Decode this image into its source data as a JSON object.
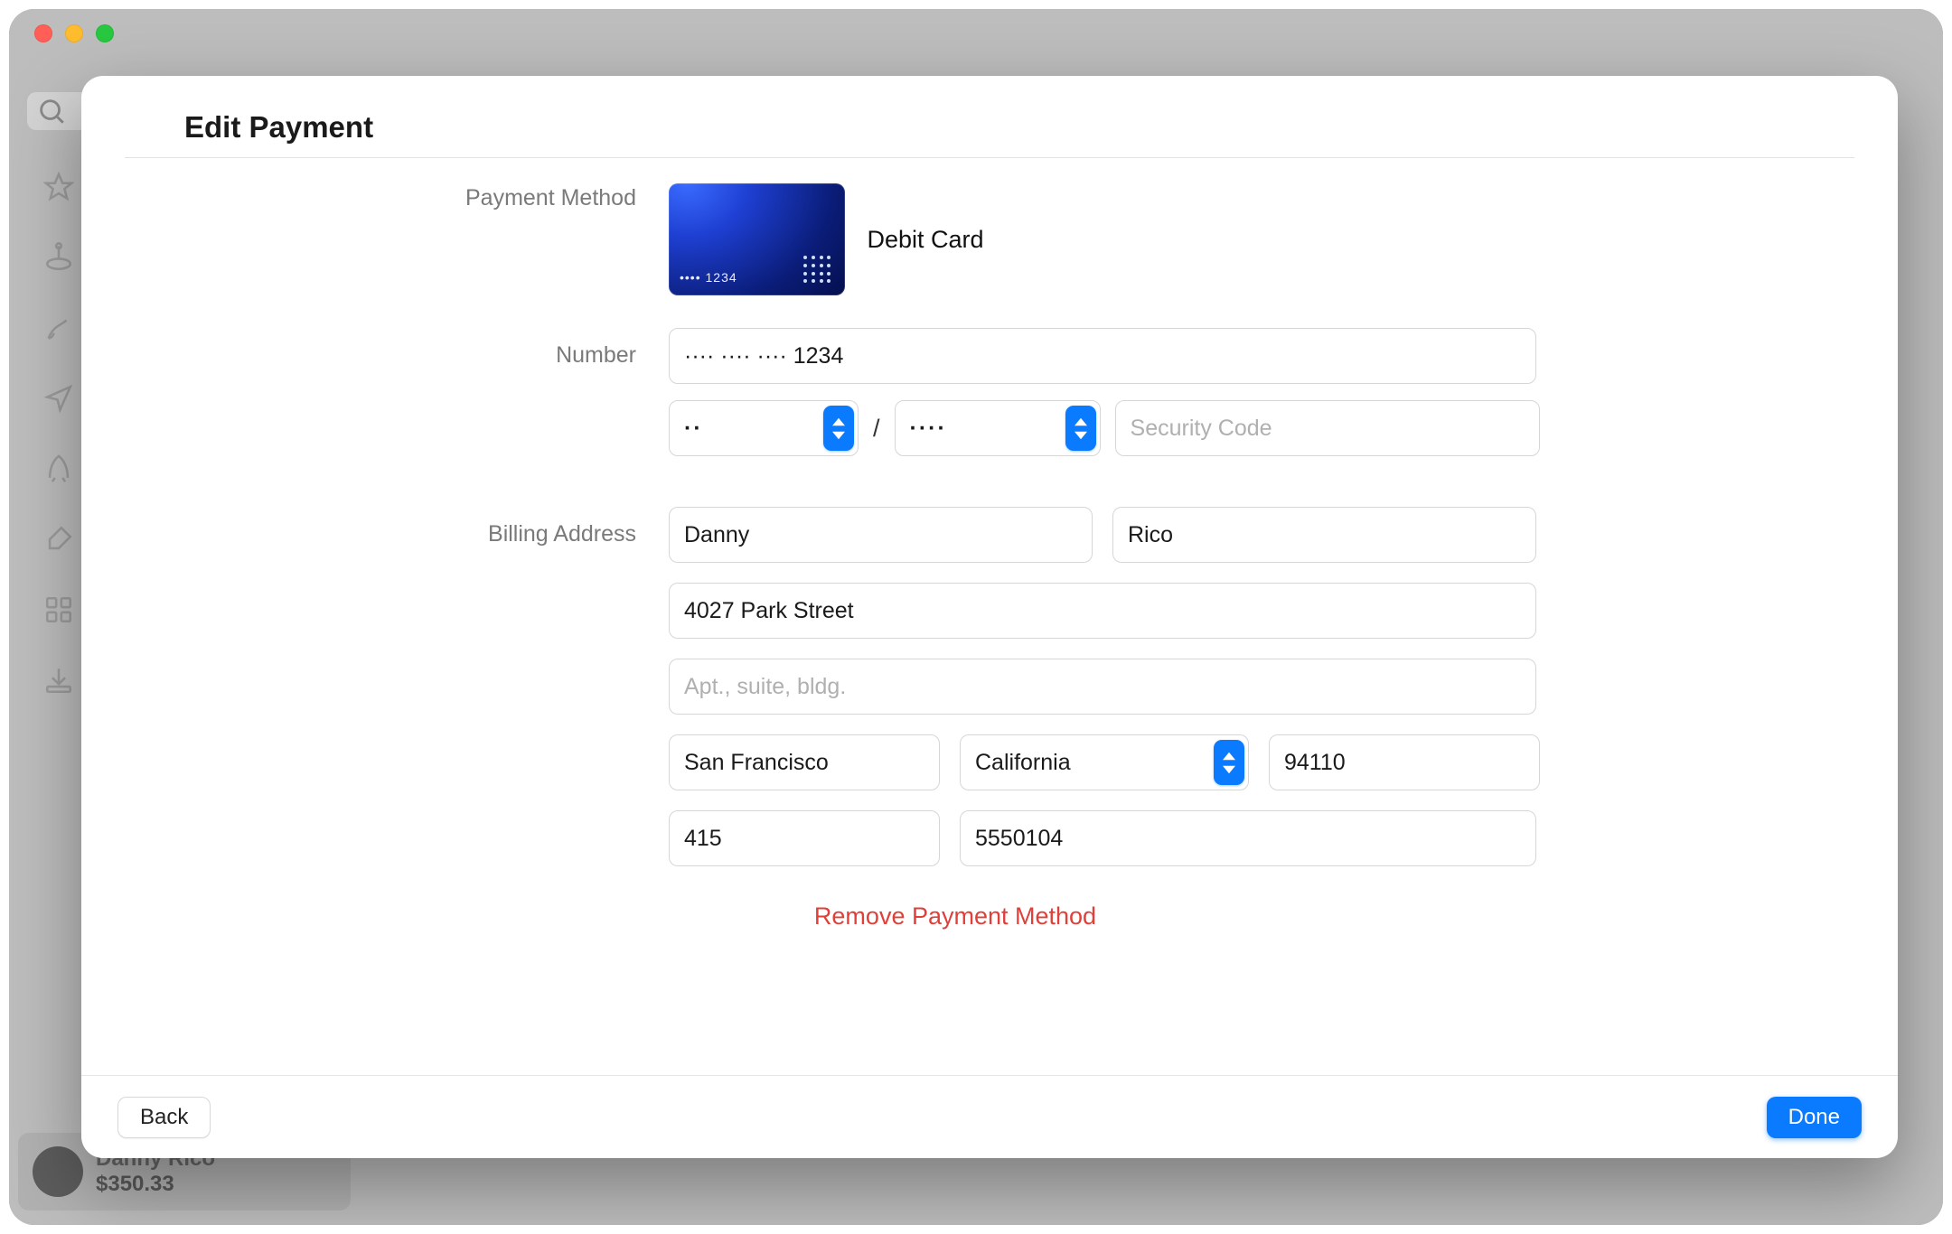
{
  "window": {
    "traffic": {
      "close": "close",
      "minimize": "minimize",
      "zoom": "zoom"
    }
  },
  "sidebar": {
    "search_placeholder": "Search",
    "icons": [
      "star",
      "download-tray",
      "brush",
      "navigation",
      "rocket",
      "wrench",
      "grid",
      "download-arrow"
    ]
  },
  "account": {
    "name": "Danny Rico",
    "balance": "$350.33"
  },
  "sheet": {
    "title": "Edit Payment",
    "labels": {
      "payment_method": "Payment Method",
      "number": "Number",
      "billing_address": "Billing Address"
    },
    "card": {
      "type": "Debit Card",
      "mask_on_card": "•••• 1234"
    },
    "number": {
      "masked": "···· ···· ···· 1234",
      "exp_month_display": "··",
      "exp_year_display": "····",
      "separator": "/",
      "security_placeholder": "Security Code"
    },
    "billing": {
      "first_name": "Danny",
      "last_name": "Rico",
      "street1": "4027 Park Street",
      "street2": "",
      "street2_placeholder": "Apt., suite, bldg.",
      "city": "San Francisco",
      "state": "California",
      "postal_code": "94110",
      "phone_area": "415",
      "phone_number": "5550104"
    },
    "remove_label": "Remove Payment Method",
    "footer": {
      "back": "Back",
      "done": "Done"
    }
  }
}
